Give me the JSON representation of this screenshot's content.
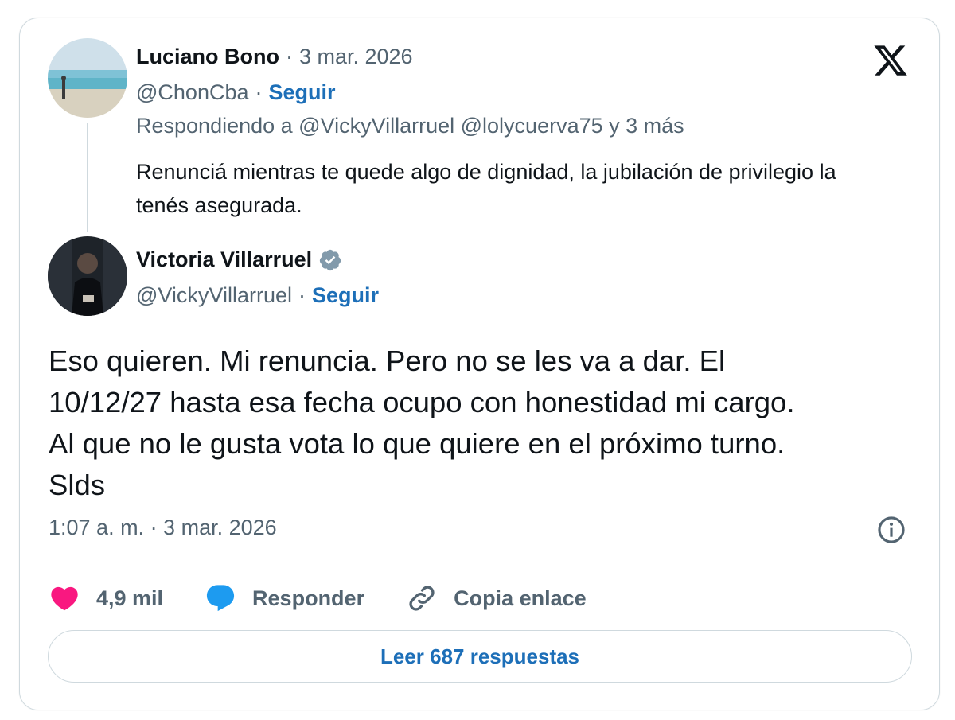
{
  "parent_tweet": {
    "author_name": "Luciano Bono",
    "separator": "·",
    "date": "3 mar. 2026",
    "handle": "@ChonCba",
    "follow_label": "Seguir",
    "replying_to": "Respondiendo a @VickyVillarruel @lolycuerva75 y 3 más",
    "text": "Renunciá mientras te quede algo de dignidad, la jubilación de privilegio la tenés asegurada."
  },
  "main_tweet": {
    "author_name": "Victoria Villarruel",
    "verified_icon": "verified-badge-icon",
    "handle": "@VickyVillarruel",
    "separator": "·",
    "follow_label": "Seguir",
    "text_lines": [
      "Eso quieren. Mi renuncia. Pero no se les va a dar. El",
      "10/12/27 hasta esa fecha ocupo con honestidad mi cargo.",
      "Al que no le gusta vota lo que quiere en el próximo turno.",
      "Slds"
    ],
    "timestamp": "1:07 a. m. · 3 mar. 2026"
  },
  "actions": {
    "likes": "4,9 mil",
    "reply_label": "Responder",
    "copy_link_label": "Copia enlace"
  },
  "read_replies_label": "Leer 687 respuestas",
  "icons": {
    "logo": "x-logo-icon",
    "info": "info-icon",
    "like": "heart-icon",
    "reply": "speech-bubble-icon",
    "link": "link-icon"
  },
  "colors": {
    "link_blue": "#1d6fb8",
    "like_pink": "#f91880",
    "reply_blue": "#1d9bf0",
    "muted_text": "#536471",
    "border": "#cfd9de"
  }
}
